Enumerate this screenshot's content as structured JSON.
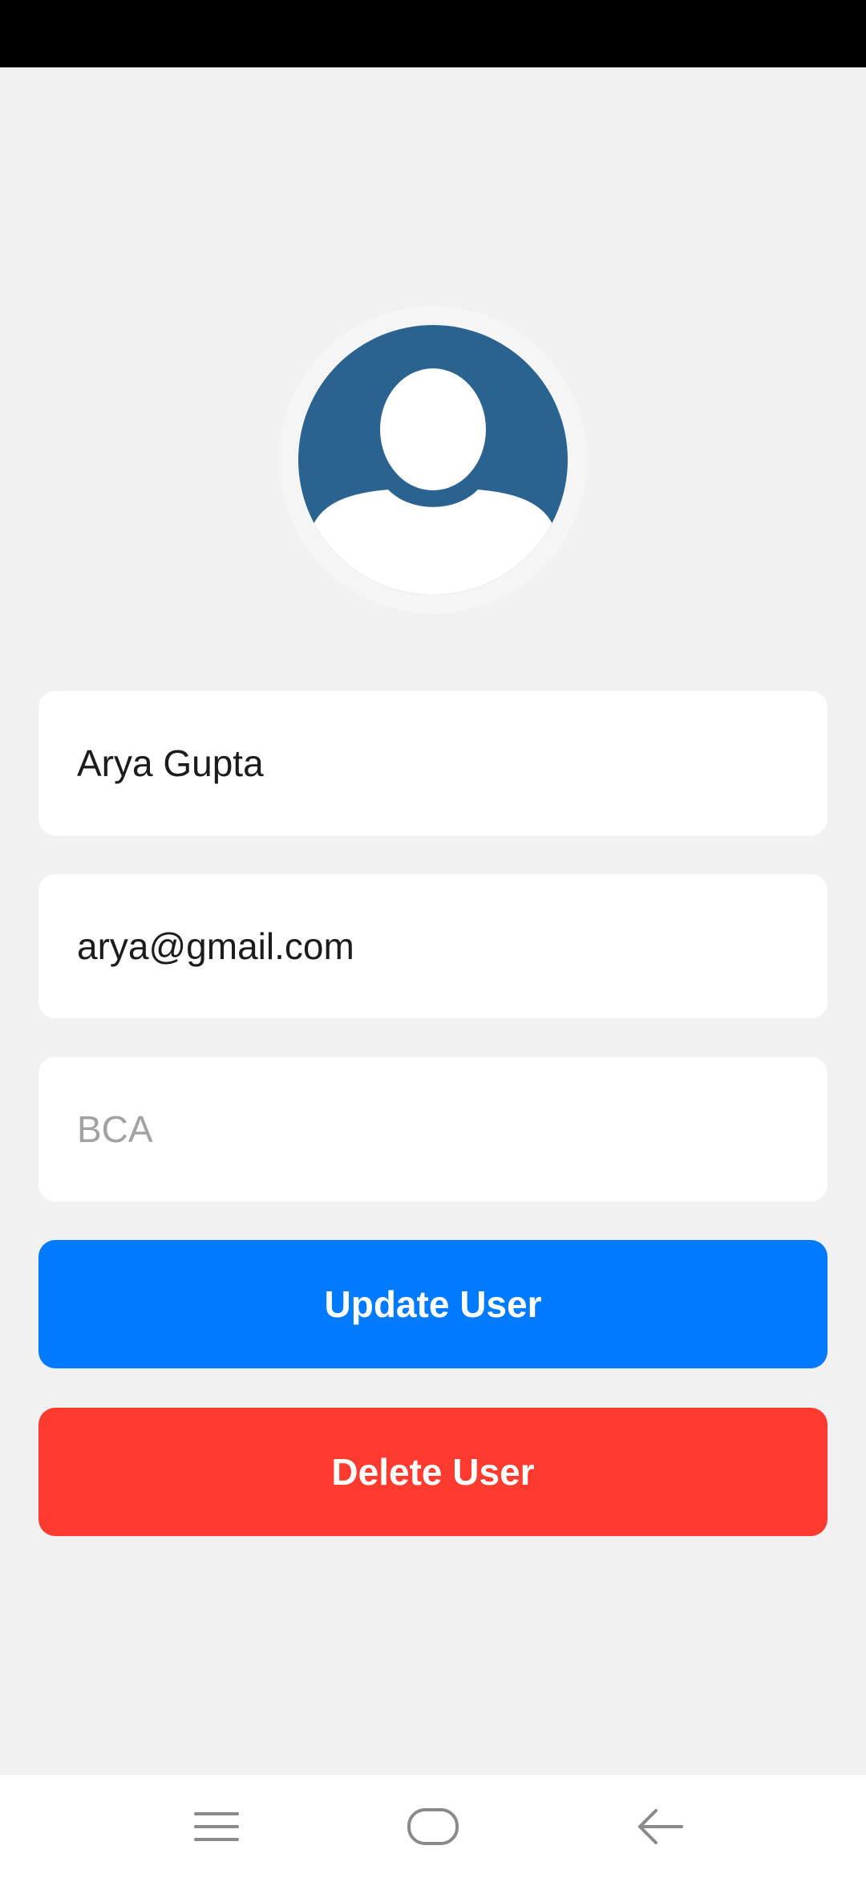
{
  "profile": {
    "avatar_icon": "user-silhouette-icon",
    "avatar_color": "#2a6290"
  },
  "form": {
    "name_value": "Arya Gupta",
    "email_value": "arya@gmail.com",
    "course_value": "",
    "course_placeholder": "BCA"
  },
  "actions": {
    "update_label": "Update User",
    "update_color": "#007aff",
    "delete_label": "Delete User",
    "delete_color": "#ff3b30"
  },
  "system_nav": {
    "menu_icon": "hamburger-menu-icon",
    "home_icon": "home-pill-icon",
    "back_icon": "back-arrow-icon"
  }
}
